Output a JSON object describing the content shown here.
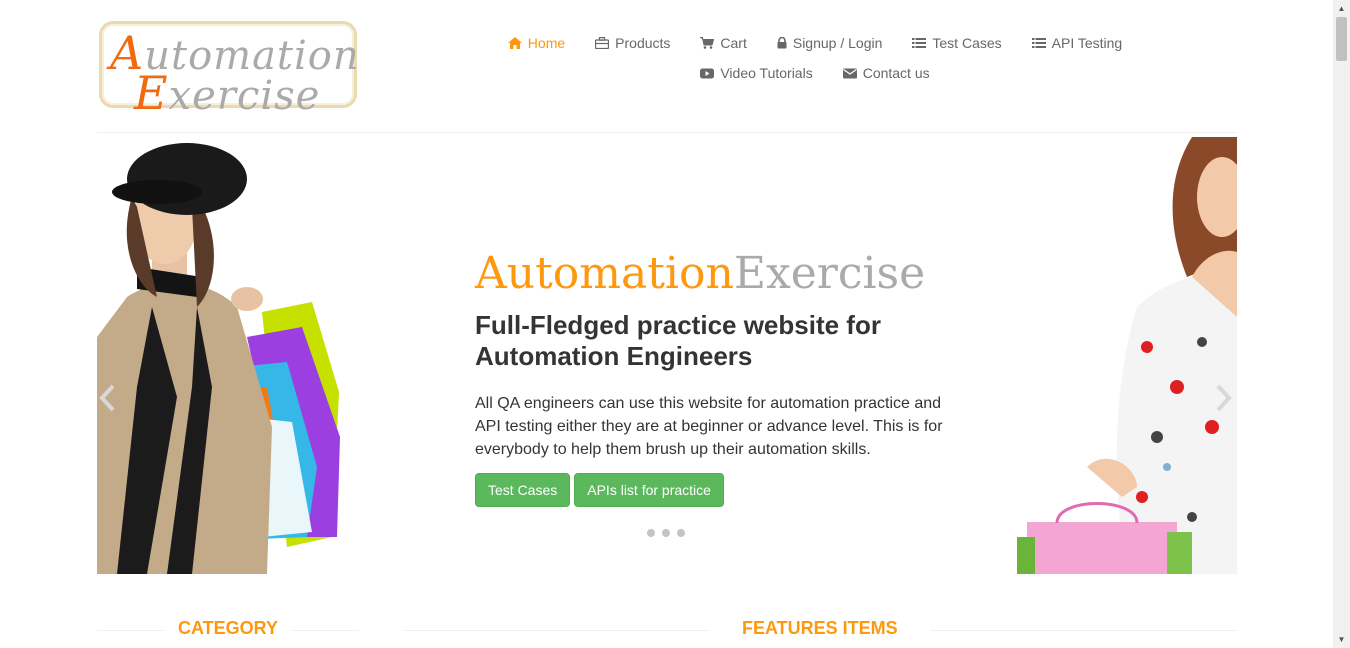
{
  "logo": {
    "line1_cap": "A",
    "line1_rest": "utomation",
    "line2_cap": "E",
    "line2_rest": "xercise"
  },
  "nav": {
    "row1": [
      {
        "label": "Home",
        "icon": "home-icon",
        "active": true
      },
      {
        "label": "Products",
        "icon": "briefcase-icon"
      },
      {
        "label": "Cart",
        "icon": "cart-icon"
      },
      {
        "label": "Signup / Login",
        "icon": "lock-icon"
      },
      {
        "label": "Test Cases",
        "icon": "list-icon"
      },
      {
        "label": "API Testing",
        "icon": "list-icon"
      }
    ],
    "row2": [
      {
        "label": "Video Tutorials",
        "icon": "youtube-play-icon"
      },
      {
        "label": "Contact us",
        "icon": "envelope-icon"
      }
    ]
  },
  "slider": {
    "brand_part1": "Automation",
    "brand_part2": "Exercise",
    "headline": "Full-Fledged practice website for Automation Engineers",
    "description": "All QA engineers can use this website for automation practice and API testing either they are at beginner or advance level. This is for everybody to help them brush up their automation skills.",
    "button_test_cases": "Test Cases",
    "button_apis": "APIs list for practice",
    "slide_count": 3
  },
  "sections": {
    "left_title": "Category",
    "right_title": "Features Items"
  },
  "colors": {
    "accent": "#fe980f",
    "button_green": "#5cb85c",
    "text": "#696763",
    "logo_orange": "#f26a10"
  }
}
